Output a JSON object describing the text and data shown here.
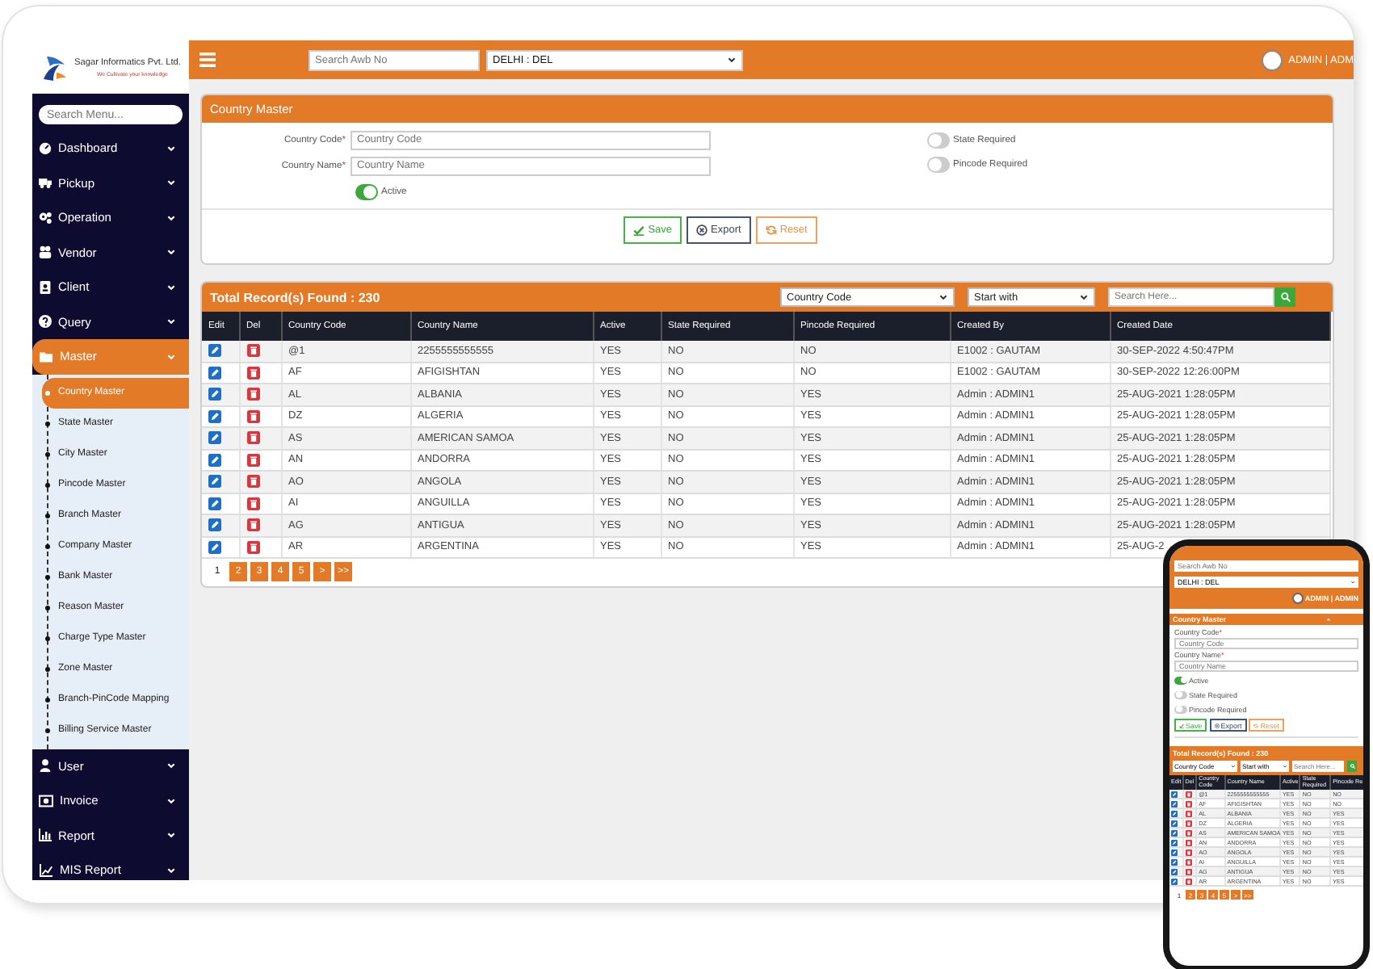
{
  "brand": {
    "name": "Sagar Informatics Pvt. Ltd.",
    "tagline": "We Cultivate your knowledge"
  },
  "sidebar": {
    "search_placeholder": "Search Menu...",
    "items": [
      {
        "label": "Dashboard",
        "expanded": false
      },
      {
        "label": "Pickup",
        "expanded": false
      },
      {
        "label": "Operation",
        "expanded": false
      },
      {
        "label": "Vendor",
        "expanded": false
      },
      {
        "label": "Client",
        "expanded": false
      },
      {
        "label": "Query",
        "expanded": false
      },
      {
        "label": "Master",
        "expanded": true,
        "children": [
          {
            "label": "Country Master",
            "selected": true
          },
          {
            "label": "State Master",
            "selected": false
          },
          {
            "label": "City Master",
            "selected": false
          },
          {
            "label": "Pincode Master",
            "selected": false
          },
          {
            "label": "Branch Master",
            "selected": false
          },
          {
            "label": "Company Master",
            "selected": false
          },
          {
            "label": "Bank Master",
            "selected": false
          },
          {
            "label": "Reason Master",
            "selected": false
          },
          {
            "label": "Charge Type Master",
            "selected": false
          },
          {
            "label": "Zone Master",
            "selected": false
          },
          {
            "label": "Branch-PinCode Mapping",
            "selected": false
          },
          {
            "label": "Billing Service Master",
            "selected": false
          }
        ]
      },
      {
        "label": "User",
        "expanded": false
      },
      {
        "label": "Invoice",
        "expanded": false
      },
      {
        "label": "Report",
        "expanded": false
      },
      {
        "label": "MIS Report",
        "expanded": false
      }
    ]
  },
  "topbar": {
    "search_placeholder": "Search Awb No",
    "location": "DELHI : DEL",
    "user": "ADMIN | ADM"
  },
  "form": {
    "title": "Country Master",
    "required_mark": "*",
    "fields": [
      {
        "label": "Country Code",
        "placeholder": "Country Code"
      },
      {
        "label": "Country Name",
        "placeholder": "Country Name"
      }
    ],
    "toggles": [
      {
        "label": "Active",
        "on": true
      },
      {
        "label": "State Required",
        "on": false
      },
      {
        "label": "Pincode Required",
        "on": false
      }
    ],
    "buttons": [
      {
        "kind": "save",
        "label": "Save"
      },
      {
        "kind": "export",
        "label": "Export"
      },
      {
        "kind": "reset",
        "label": "Reset"
      }
    ]
  },
  "records": {
    "title": "Total Record(s) Found : 230",
    "field_filter": "Country Code",
    "match_filter": "Start with",
    "search_placeholder": "Search Here...",
    "action_columns": [
      "Edit",
      "Del"
    ],
    "columns": [
      "Country Code",
      "Country Name",
      "Active",
      "State Required",
      "Pincode Required",
      "Created By",
      "Created Date"
    ],
    "rows": [
      [
        "@1",
        "2255555555555",
        "YES",
        "NO",
        "NO",
        "E1002 : GAUTAM",
        "30-SEP-2022 4:50:47PM"
      ],
      [
        "AF",
        "AFIGISHTAN",
        "YES",
        "NO",
        "NO",
        "E1002 : GAUTAM",
        "30-SEP-2022 12:26:00PM"
      ],
      [
        "AL",
        "ALBANIA",
        "YES",
        "NO",
        "YES",
        "Admin : ADMIN1",
        "25-AUG-2021 1:28:05PM"
      ],
      [
        "DZ",
        "ALGERIA",
        "YES",
        "NO",
        "YES",
        "Admin : ADMIN1",
        "25-AUG-2021 1:28:05PM"
      ],
      [
        "AS",
        "AMERICAN SAMOA",
        "YES",
        "NO",
        "YES",
        "Admin : ADMIN1",
        "25-AUG-2021 1:28:05PM"
      ],
      [
        "AN",
        "ANDORRA",
        "YES",
        "NO",
        "YES",
        "Admin : ADMIN1",
        "25-AUG-2021 1:28:05PM"
      ],
      [
        "AO",
        "ANGOLA",
        "YES",
        "NO",
        "YES",
        "Admin : ADMIN1",
        "25-AUG-2021 1:28:05PM"
      ],
      [
        "AI",
        "ANGUILLA",
        "YES",
        "NO",
        "YES",
        "Admin : ADMIN1",
        "25-AUG-2021 1:28:05PM"
      ],
      [
        "AG",
        "ANTIGUA",
        "YES",
        "NO",
        "YES",
        "Admin : ADMIN1",
        "25-AUG-2021 1:28:05PM"
      ],
      [
        "AR",
        "ARGENTINA",
        "YES",
        "NO",
        "YES",
        "Admin : ADMIN1",
        "25-AUG-2"
      ]
    ],
    "pages": [
      {
        "label": "1",
        "selected": true
      },
      {
        "label": "2",
        "selected": false
      },
      {
        "label": "3",
        "selected": false
      },
      {
        "label": "4",
        "selected": false
      },
      {
        "label": "5",
        "selected": false
      },
      {
        "label": ">",
        "selected": false
      },
      {
        "label": ">>",
        "selected": false
      }
    ]
  },
  "phone": {
    "search_placeholder": "Search Awb No",
    "location": "DELHI : DEL",
    "user": "ADMIN | ADMIN",
    "form": {
      "title": "Country Master",
      "required_mark": "*",
      "fields": [
        {
          "label": "Country Code",
          "placeholder": "Country Code"
        },
        {
          "label": "Country Name",
          "placeholder": "Country Name"
        }
      ],
      "toggles": [
        {
          "label": "Active",
          "on": true
        },
        {
          "label": "State Required",
          "on": false
        },
        {
          "label": "Pincode Required",
          "on": false
        }
      ],
      "buttons": [
        {
          "kind": "save",
          "label": "Save"
        },
        {
          "kind": "export",
          "label": "Export"
        },
        {
          "kind": "reset",
          "label": "Reset"
        }
      ]
    },
    "records": {
      "title": "Total Record(s) Found : 230",
      "field_filter": "Country Code",
      "match_filter": "Start with",
      "search_placeholder": "Search Here...",
      "action_columns": [
        "Edit",
        "Del"
      ],
      "columns": [
        "Country Code",
        "Country Name",
        "Active",
        "State Required",
        "Pincode Re"
      ],
      "rows": [
        [
          "@1",
          "2255555555555",
          "YES",
          "NO",
          "NO"
        ],
        [
          "AF",
          "AFIGISHTAN",
          "YES",
          "NO",
          "NO"
        ],
        [
          "AL",
          "ALBANIA",
          "YES",
          "NO",
          "YES"
        ],
        [
          "DZ",
          "ALGERIA",
          "YES",
          "NO",
          "YES"
        ],
        [
          "AS",
          "AMERICAN SAMOA",
          "YES",
          "NO",
          "YES"
        ],
        [
          "AN",
          "ANDORRA",
          "YES",
          "NO",
          "YES"
        ],
        [
          "AO",
          "ANGOLA",
          "YES",
          "NO",
          "YES"
        ],
        [
          "AI",
          "ANGUILLA",
          "YES",
          "NO",
          "YES"
        ],
        [
          "AG",
          "ANTIGUA",
          "YES",
          "NO",
          "YES"
        ],
        [
          "AR",
          "ARGENTINA",
          "YES",
          "NO",
          "YES"
        ]
      ],
      "pages": [
        {
          "label": "1",
          "selected": true
        },
        {
          "label": "2",
          "selected": false
        },
        {
          "label": "3",
          "selected": false
        },
        {
          "label": "4",
          "selected": false
        },
        {
          "label": "5",
          "selected": false
        },
        {
          "label": ">",
          "selected": false
        },
        {
          "label": ">>",
          "selected": false
        }
      ]
    }
  }
}
